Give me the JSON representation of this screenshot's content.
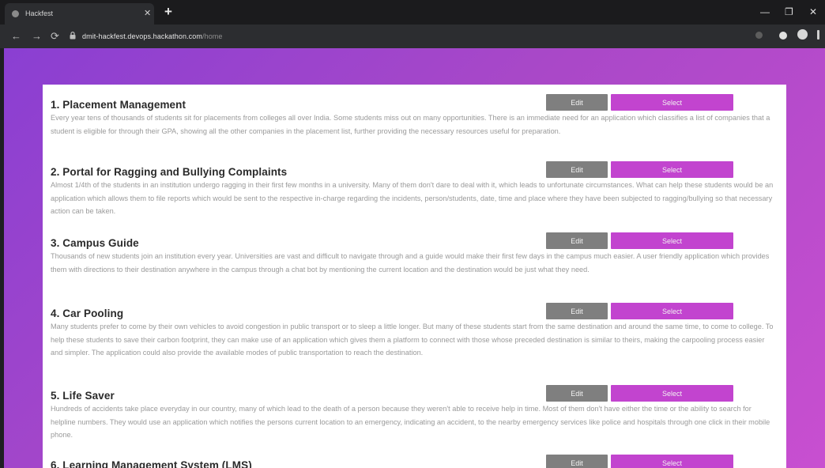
{
  "browser": {
    "tab_title": "Hackfest",
    "tab_close": "✕",
    "new_tab": "+",
    "url_main": "dmit-hackfest.devops.hackathon.com",
    "url_path": "/home",
    "minimize": "—",
    "maximize": "❐",
    "close": "✕",
    "back": "←",
    "forward": "→",
    "reload": "⟳"
  },
  "projects": [
    {
      "title": "1. Placement Management",
      "description": "Every year tens of thousands of students sit for placements from colleges all over India. Some students miss out on many opportunities. There is an immediate need for an application which classifies a list of companies that a student is eligible for through their GPA, showing all the other companies in the placement list, further providing the necessary resources useful for preparation.",
      "edit_label": "Edit",
      "select_label": "Select"
    },
    {
      "title": "2. Portal for Ragging and Bullying Complaints",
      "description": "Almost 1/4th of the students in an institution undergo ragging in their first few months in a university. Many of them don't dare to deal with it, which leads to unfortunate circumstances. What can help these students would be an application which allows them to file reports which would be sent to the respective in-charge regarding the incidents, person/students, date, time and place where they have been subjected to ragging/bullying so that necessary action can be taken.",
      "edit_label": "Edit",
      "select_label": "Select"
    },
    {
      "title": "3. Campus Guide",
      "description": "Thousands of new students join an institution every year. Universities are vast and difficult to navigate through and a guide would make their first few days in the campus much easier. A user friendly application which provides them with directions to their destination anywhere in the campus through a chat bot by mentioning the current location and the destination would be just what they need.",
      "edit_label": "Edit",
      "select_label": "Select"
    },
    {
      "title": "4. Car Pooling",
      "description": "Many students prefer to come by their own vehicles to avoid congestion in public transport or to sleep a little longer. But many of these students start from the same destination and around the same time, to come to college. To help these students to save their carbon footprint, they can make use of an application which gives them a platform to connect with those whose preceded destination is similar to theirs, making the carpooling process easier and simpler. The application could also provide the available modes of public transportation to reach the destination.",
      "edit_label": "Edit",
      "select_label": "Select"
    },
    {
      "title": "5. Life Saver",
      "description": "Hundreds of accidents take place everyday in our country, many of which lead to the death of a person because they weren't able to receive help in time. Most of them don't have either the time or the ability to search for helpline numbers. They would use an application which notifies the persons current location to an emergency, indicating an accident, to the nearby emergency services like police and hospitals through one click in their mobile phone.",
      "edit_label": "Edit",
      "select_label": "Select"
    },
    {
      "title": "6. Learning Management System (LMS)",
      "description": "",
      "edit_label": "Edit",
      "select_label": "Select"
    }
  ]
}
